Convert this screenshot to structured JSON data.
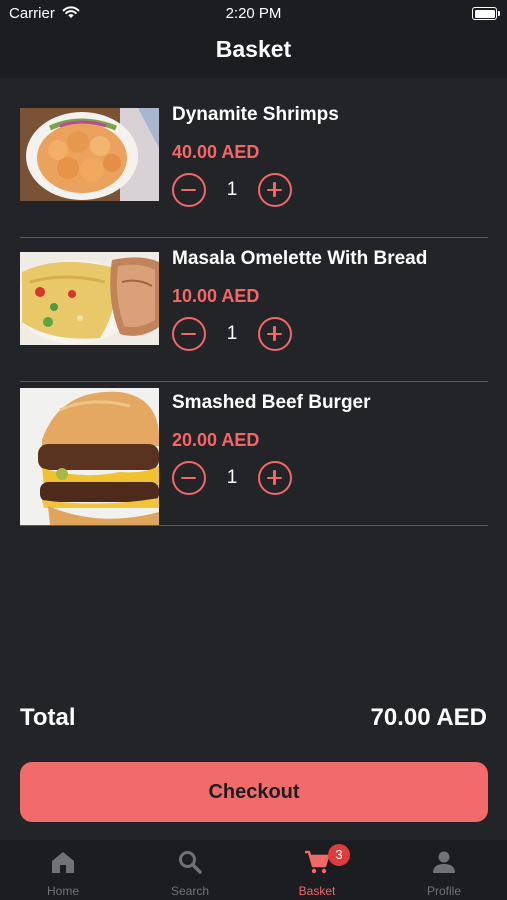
{
  "status_bar": {
    "carrier": "Carrier",
    "time": "2:20 PM"
  },
  "header": {
    "title": "Basket"
  },
  "basket": {
    "items": [
      {
        "name": "Dynamite Shrimps",
        "price": "40.00 AED",
        "quantity": "1",
        "image_icon": "dynamite-shrimps-photo"
      },
      {
        "name": "Masala Omelette With Bread",
        "price": "10.00 AED",
        "quantity": "1",
        "image_icon": "masala-omelette-photo"
      },
      {
        "name": "Smashed Beef Burger",
        "price": "20.00 AED",
        "quantity": "1",
        "image_icon": "beef-burger-photo"
      }
    ]
  },
  "summary": {
    "total_label": "Total",
    "total_value": "70.00 AED"
  },
  "checkout": {
    "label": "Checkout"
  },
  "tab_bar": {
    "tabs": [
      {
        "label": "Home",
        "icon": "home-icon",
        "active": false
      },
      {
        "label": "Search",
        "icon": "search-icon",
        "active": false
      },
      {
        "label": "Basket",
        "icon": "cart-icon",
        "active": true,
        "badge": "3"
      },
      {
        "label": "Profile",
        "icon": "person-icon",
        "active": false
      }
    ]
  },
  "colors": {
    "background": "#232427",
    "bars": "#1c1d20",
    "accent": "#f26868",
    "badge": "#e23b3b",
    "divider": "#595b61",
    "inactive_tab": "#707278"
  }
}
